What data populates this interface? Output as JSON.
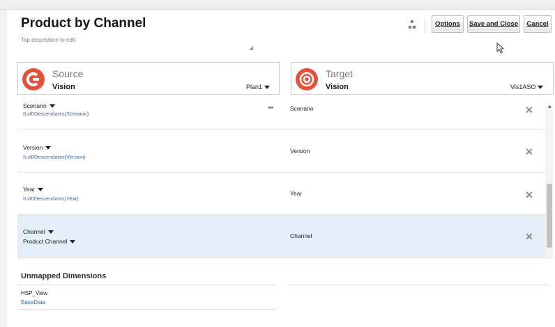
{
  "header": {
    "title": "Product by Channel",
    "description_placeholder": "Tap description to edit",
    "buttons": {
      "options": "Options",
      "save_close": "Save and Close",
      "cancel": "Cancel"
    }
  },
  "source": {
    "label": "Source",
    "app": "Vision",
    "db": "Plan1",
    "icon": "oracle-c-icon"
  },
  "target": {
    "label": "Target",
    "app": "Vision",
    "db": "Vis1ASO",
    "icon": "target-app-icon"
  },
  "mappings": [
    {
      "source_dim": "Scenario",
      "source_member": "ILvl0Descendants(Scenario)",
      "target_dim": "Scenario",
      "selected": false
    },
    {
      "source_dim": "Version",
      "source_member": "ILvl0Descendants(Version)",
      "target_dim": "Version",
      "selected": false
    },
    {
      "source_dim": "Year",
      "source_member": "ILvl0Descendants(Year)",
      "target_dim": "Year",
      "selected": false
    },
    {
      "source_dim": "Channel",
      "source_member": "Product Channel",
      "target_dim": "Channel",
      "selected": true
    }
  ],
  "unmapped": {
    "title": "Unmapped Dimensions",
    "items": [
      {
        "dim": "HSP_View",
        "member": "BaseData"
      }
    ]
  },
  "icons": {
    "more": "more-ellipsis-icon",
    "remove": "close-x-icon",
    "hierarchy": "hierarchy-icon"
  }
}
